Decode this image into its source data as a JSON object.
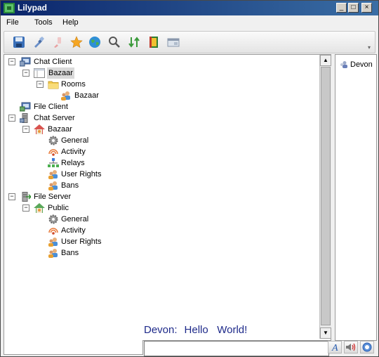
{
  "window": {
    "title": "Lilypad",
    "minimize_label": "_",
    "maximize_label": "□",
    "close_label": "×"
  },
  "menu": {
    "items": [
      "File",
      "Tools",
      "Help"
    ]
  },
  "toolbar": {
    "buttons": [
      "save-icon",
      "connect-icon",
      "disconnect-icon",
      "favorite-star-icon",
      "globe-icon",
      "search-icon",
      "transfer-icon",
      "book-icon",
      "window-icon"
    ]
  },
  "tree": {
    "nodes": [
      {
        "label": "Chat Client",
        "icon": "chat-client-icon",
        "expanded": true
      },
      {
        "label": "Bazaar",
        "icon": "room-window-icon",
        "expanded": true,
        "selected": true
      },
      {
        "label": "Rooms",
        "icon": "folder-icon",
        "expanded": true
      },
      {
        "label": "Bazaar",
        "icon": "users-icon"
      },
      {
        "label": "File Client",
        "icon": "file-client-icon"
      },
      {
        "label": "Chat Server",
        "icon": "chat-server-icon",
        "expanded": true
      },
      {
        "label": "Bazaar",
        "icon": "home-icon",
        "expanded": true
      },
      {
        "label": "General",
        "icon": "gear-icon"
      },
      {
        "label": "Activity",
        "icon": "activity-icon"
      },
      {
        "label": "Relays",
        "icon": "relays-icon"
      },
      {
        "label": "User Rights",
        "icon": "user-rights-icon"
      },
      {
        "label": "Bans",
        "icon": "bans-icon"
      },
      {
        "label": "File Server",
        "icon": "file-server-icon",
        "expanded": true
      },
      {
        "label": "Public",
        "icon": "home-icon",
        "expanded": true
      },
      {
        "label": "General",
        "icon": "gear-icon"
      },
      {
        "label": "Activity",
        "icon": "activity-icon"
      },
      {
        "label": "User Rights",
        "icon": "user-rights-icon"
      },
      {
        "label": "Bans",
        "icon": "bans-icon"
      }
    ]
  },
  "chat": {
    "speaker": "Devon:",
    "message": "Hello   World!",
    "input_value": ""
  },
  "users": {
    "items": [
      {
        "name": "Devon",
        "icon": "user-icon"
      }
    ]
  },
  "bottom_buttons": [
    "font-icon",
    "sound-icon",
    "emoticon-icon"
  ],
  "colors": {
    "accent": "#0a246a",
    "chat_text": "#1e2a8a",
    "selection": "#d9d9d9"
  }
}
